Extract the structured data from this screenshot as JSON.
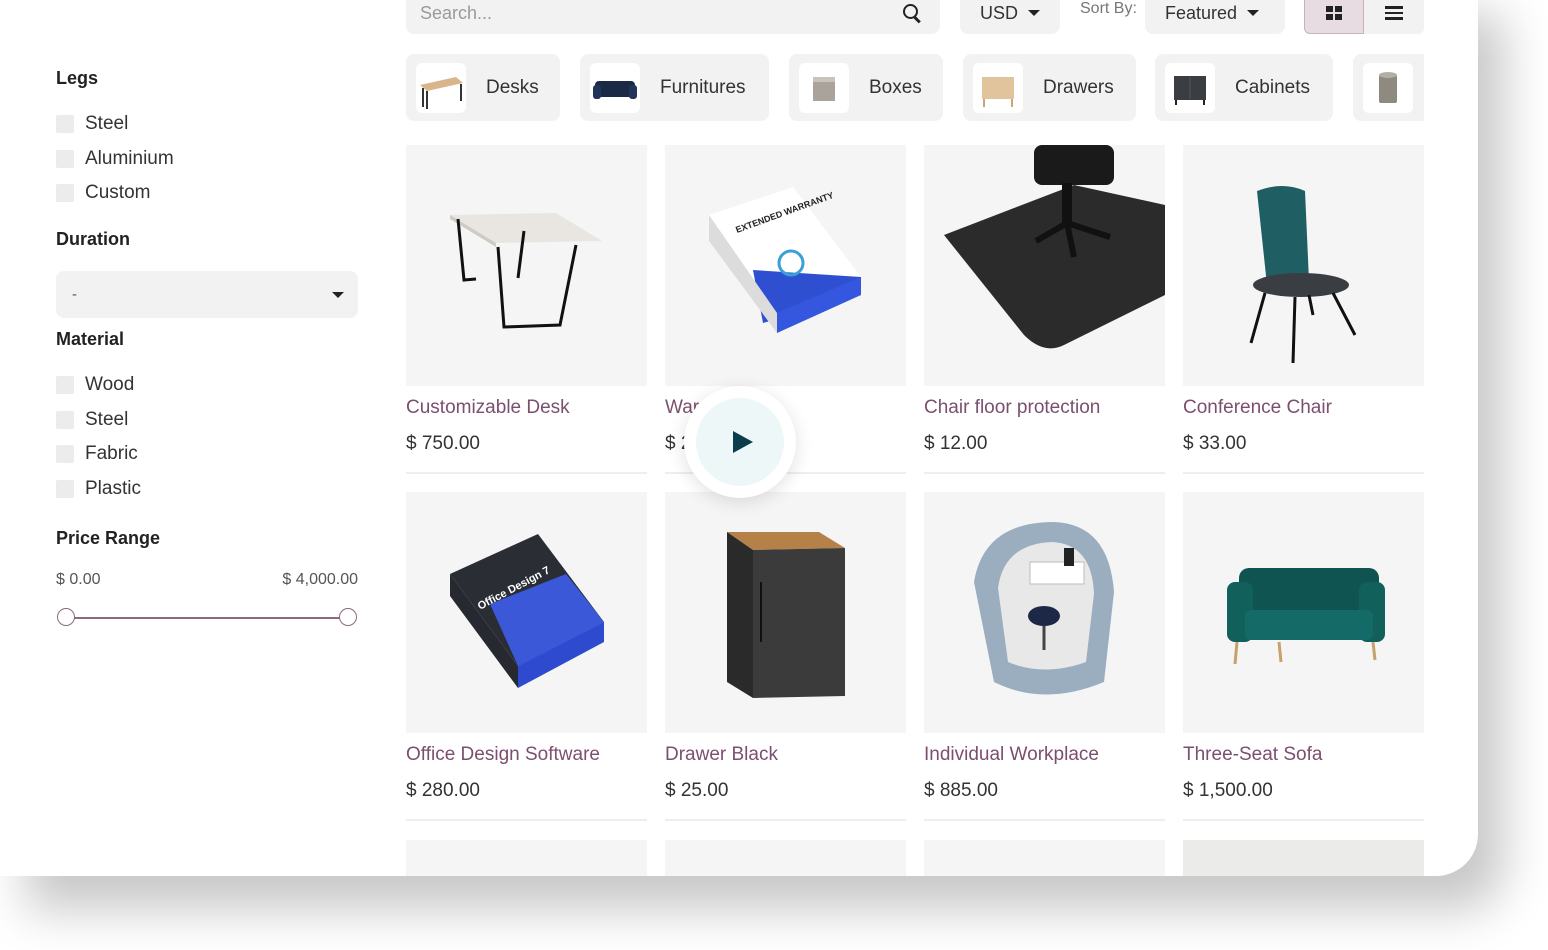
{
  "search": {
    "placeholder": "Search..."
  },
  "currency": {
    "value": "USD"
  },
  "sort": {
    "label": "Sort By:",
    "value": "Featured"
  },
  "sidebar": {
    "legs": {
      "title": "Legs",
      "options": [
        "Steel",
        "Aluminium",
        "Custom"
      ]
    },
    "duration": {
      "title": "Duration",
      "value": "-"
    },
    "material": {
      "title": "Material",
      "options": [
        "Wood",
        "Steel",
        "Fabric",
        "Plastic"
      ]
    },
    "price_range": {
      "title": "Price Range",
      "min": "$ 0.00",
      "max": "$ 4,000.00"
    }
  },
  "categories": [
    {
      "name": "Desks",
      "icon": "desk-icon"
    },
    {
      "name": "Furnitures",
      "icon": "sofa-icon"
    },
    {
      "name": "Boxes",
      "icon": "box-icon"
    },
    {
      "name": "Drawers",
      "icon": "drawer-icon"
    },
    {
      "name": "Cabinets",
      "icon": "cabinet-icon"
    },
    {
      "name": "",
      "icon": "bin-icon"
    }
  ],
  "products": [
    {
      "name": "Customizable Desk",
      "price": "$ 750.00"
    },
    {
      "name": "Warr",
      "price": "$ 2"
    },
    {
      "name": "Chair floor protection",
      "price": "$ 12.00"
    },
    {
      "name": "Conference Chair",
      "price": "$ 33.00"
    },
    {
      "name": "Office Design Software",
      "price": "$ 280.00"
    },
    {
      "name": "Drawer Black",
      "price": "$ 25.00"
    },
    {
      "name": "Individual Workplace",
      "price": "$ 885.00"
    },
    {
      "name": "Three-Seat Sofa",
      "price": "$ 1,500.00"
    }
  ],
  "warranty_box_text": "EXTENDED WARRANTY",
  "software_box_text": "Office Design 7",
  "colors": {
    "accent": "#7b4f6f",
    "play": "#0c3d4d",
    "slider": "#8a6b7e"
  }
}
